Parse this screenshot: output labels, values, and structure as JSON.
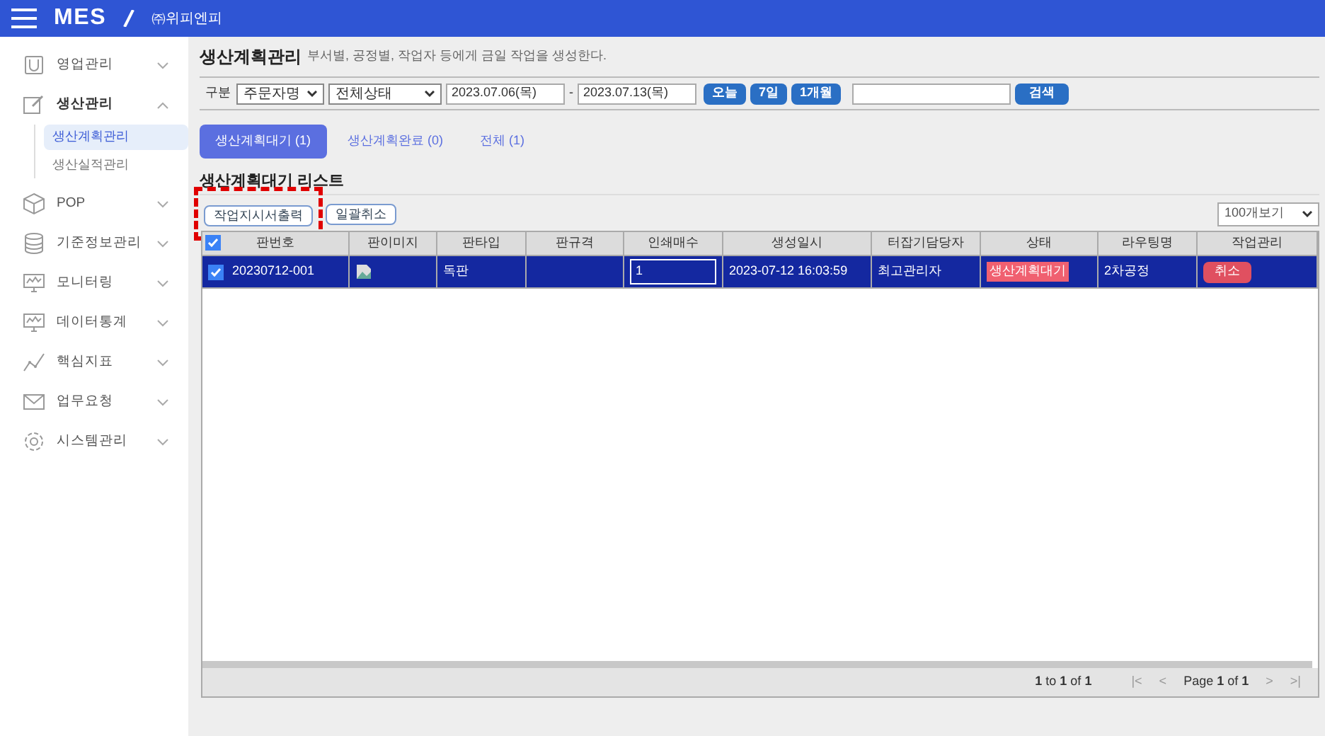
{
  "header": {
    "logo": "MES",
    "company": "㈜위피엔피"
  },
  "sidebar": {
    "items": [
      {
        "label": "영업관리",
        "expanded": false
      },
      {
        "label": "생산관리",
        "expanded": true,
        "children": [
          {
            "label": "생산계획관리",
            "selected": true
          },
          {
            "label": "생산실적관리",
            "selected": false
          }
        ]
      },
      {
        "label": "POP",
        "expanded": false
      },
      {
        "label": "기준정보관리",
        "expanded": false
      },
      {
        "label": "모니터링",
        "expanded": false
      },
      {
        "label": "데이터통계",
        "expanded": false
      },
      {
        "label": "핵심지표",
        "expanded": false
      },
      {
        "label": "업무요청",
        "expanded": false
      },
      {
        "label": "시스템관리",
        "expanded": false
      }
    ]
  },
  "page": {
    "title": "생산계획관리",
    "description": "부서별, 공정별, 작업자 등에게 금일 작업을 생성한다."
  },
  "filter": {
    "label": "구분",
    "select_1": "주문자명",
    "select_2": "전체상태",
    "date_from": "2023.07.06(목)",
    "separator": "-",
    "date_to": "2023.07.13(목)",
    "quick_buttons": [
      "오늘",
      "7일",
      "1개월"
    ],
    "search_button": "검색"
  },
  "tabs": [
    {
      "label": "생산계획대기 (1)",
      "selected": true
    },
    {
      "label": "생산계획완료 (0)",
      "selected": false
    },
    {
      "label": "전체 (1)",
      "selected": false
    }
  ],
  "list_title": "생산계획대기 리스트",
  "actions": [
    {
      "label": "작업지시서출력",
      "highlighted": true
    },
    {
      "label": "일괄취소",
      "highlighted": false
    }
  ],
  "page_size": "100개보기",
  "table": {
    "header_checked": true,
    "columns": [
      "판번호",
      "판이미지",
      "판타입",
      "판규격",
      "인쇄매수",
      "생성일시",
      "터잡기담당자",
      "상태",
      "라우팅명",
      "작업관리"
    ],
    "rows": [
      {
        "selected": true,
        "checked": true,
        "number": "20230712-001",
        "type": "독판",
        "copies": "1",
        "created": "2023-07-12 16:03:59",
        "manager": "최고관리자",
        "status": "생산계획대기",
        "routing": "2차공정",
        "action": "취소"
      }
    ]
  },
  "footer": {
    "range": "**1** to **1** of **1**",
    "page": "Page **1** of **1**",
    "nav": [
      "|<",
      "<",
      ">",
      ">|"
    ]
  }
}
